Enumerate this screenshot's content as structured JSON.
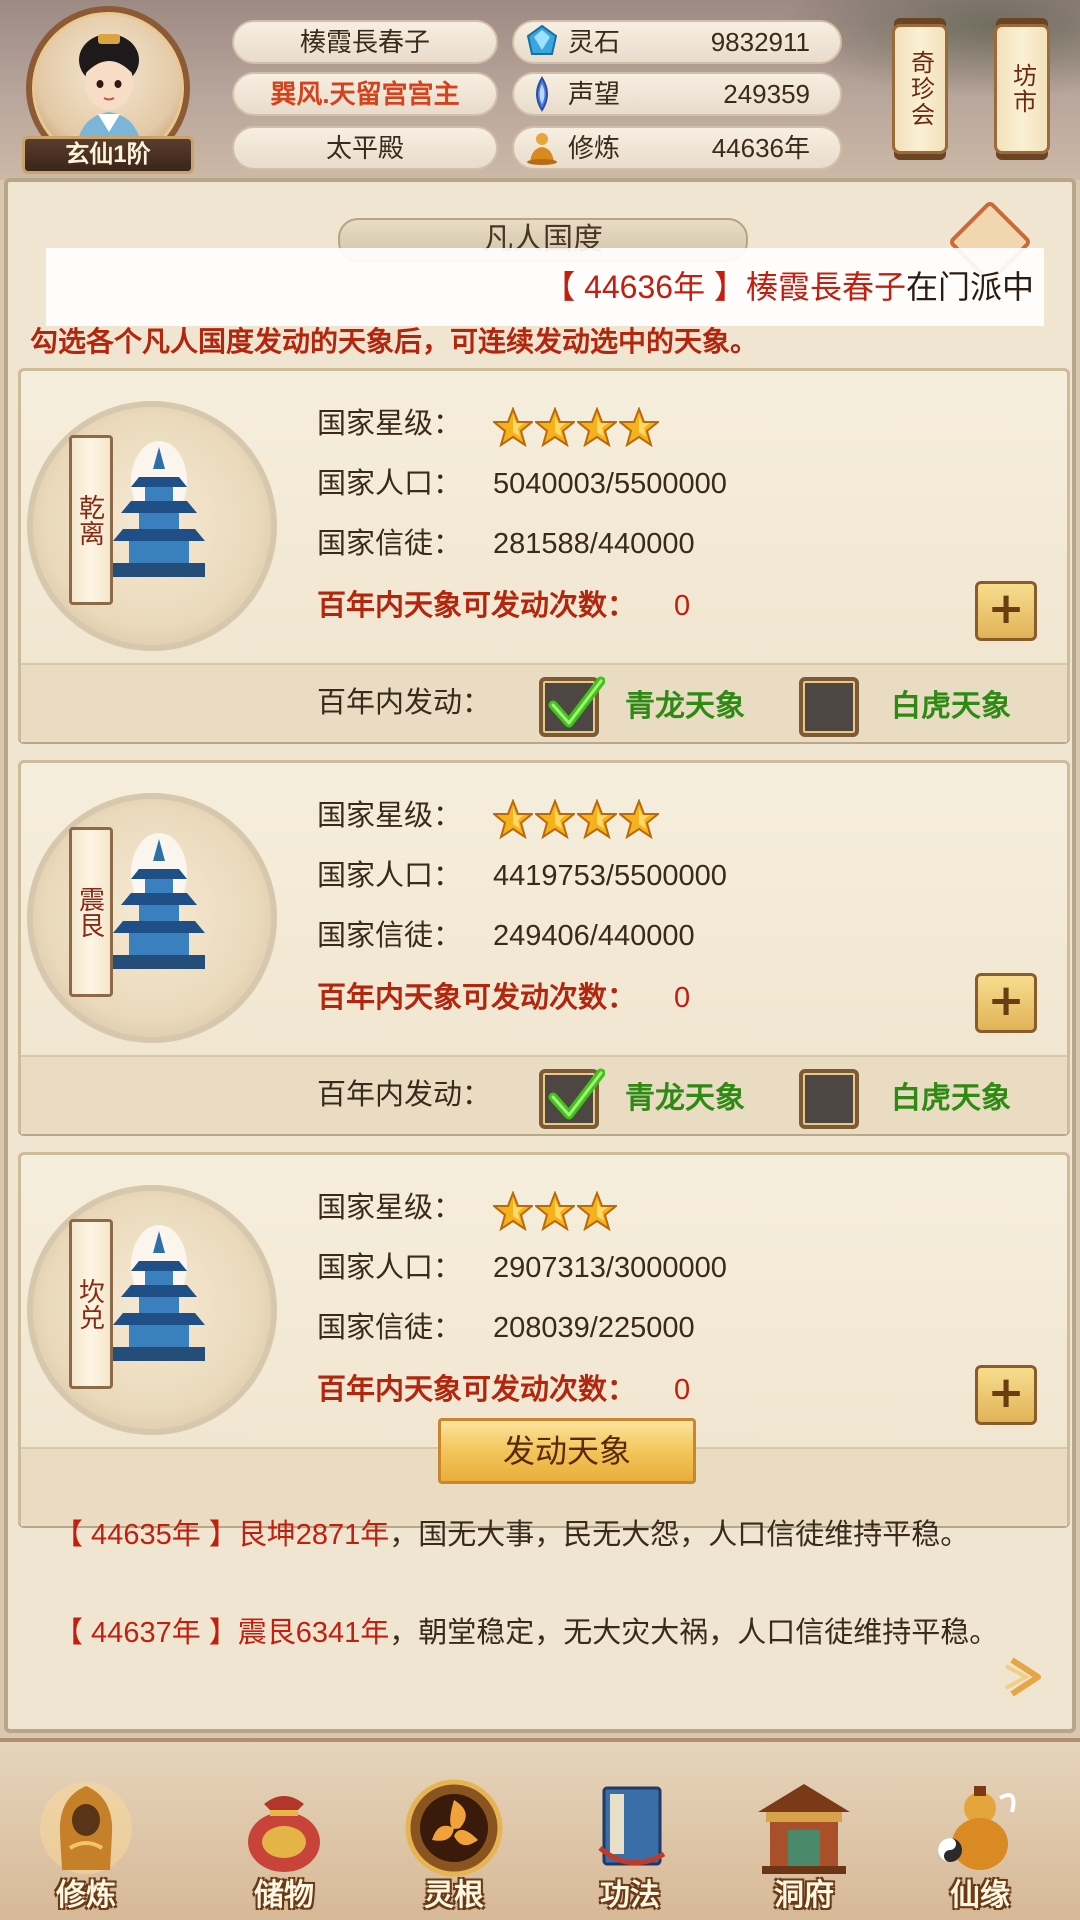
{
  "player": {
    "rank": "玄仙1阶",
    "name": "楱霞長春子",
    "title": "巽风.天留宫宫主",
    "hall": "太平殿"
  },
  "resources": [
    {
      "icon": "spirit-stone-icon",
      "label": "灵石",
      "value": "9832911"
    },
    {
      "icon": "reputation-crystal-icon",
      "label": "声望",
      "value": "249359"
    },
    {
      "icon": "meditation-icon",
      "label": "修炼",
      "value": "44636年"
    }
  ],
  "top_buttons": {
    "treasure": "奇珍会",
    "market": "坊市"
  },
  "panel": {
    "title": "凡人国度",
    "marquee": {
      "year": "【 44636年 】",
      "who": "楱霞長春子",
      "rest": "在门派中"
    },
    "hint": "勾选各个凡人国度发动的天象后，可连续发动选中的天象。"
  },
  "labels": {
    "stars": "国家星级：",
    "population": "国家人口：",
    "believers": "国家信徒：",
    "launch_count": "百年内天象可发动次数：",
    "launch": "百年内发动：",
    "option_a": "青龙天象",
    "option_b": "白虎天象",
    "plus": "+"
  },
  "countries": [
    {
      "name": "乾离",
      "stars": 4,
      "population": "5040003/5500000",
      "believers": "281588/440000",
      "launch_count": "0",
      "qinglong": true,
      "baihu": false
    },
    {
      "name": "震艮",
      "stars": 4,
      "population": "4419753/5500000",
      "believers": "249406/440000",
      "launch_count": "0",
      "qinglong": true,
      "baihu": false
    },
    {
      "name": "坎兑",
      "stars": 3,
      "population": "2907313/3000000",
      "believers": "208039/225000",
      "launch_count": "0",
      "qinglong": false,
      "baihu": false
    }
  ],
  "launch_button": "发动天象",
  "logs": [
    {
      "year": "【 44635年 】",
      "topic": "艮坤2871年",
      "text": "，国无大事，民无大怨，人口信徒维持平稳。"
    },
    {
      "year": "【 44637年 】",
      "topic": "震艮6341年",
      "text": "，朝堂稳定，无大灾大祸，人口信徒维持平稳。"
    }
  ],
  "nav": [
    {
      "icon": "cultivate-icon",
      "label": "修炼"
    },
    {
      "icon": "storage-bag-icon",
      "label": "储物"
    },
    {
      "icon": "spirit-root-icon",
      "label": "灵根"
    },
    {
      "icon": "technique-book-icon",
      "label": "功法"
    },
    {
      "icon": "cave-mansion-icon",
      "label": "洞府"
    },
    {
      "icon": "destiny-gourd-icon",
      "label": "仙缘"
    }
  ],
  "colors": {
    "accent_red": "#c41e0e",
    "check_green": "#2f8a14",
    "gold": "#f3c55a"
  }
}
